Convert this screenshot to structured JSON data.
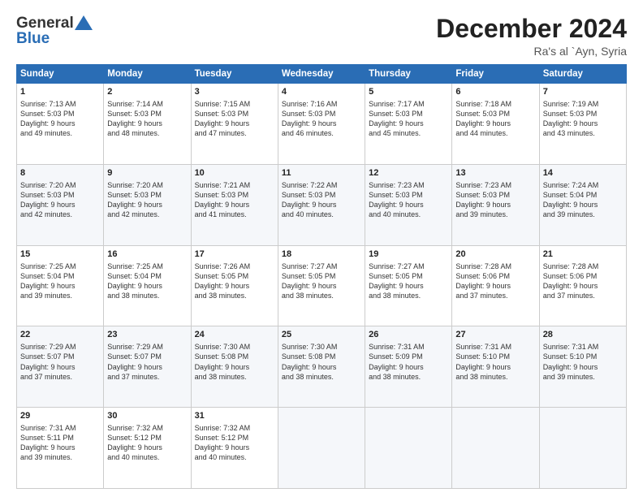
{
  "header": {
    "logo_general": "General",
    "logo_blue": "Blue",
    "month_title": "December 2024",
    "location": "Ra's al `Ayn, Syria"
  },
  "days_of_week": [
    "Sunday",
    "Monday",
    "Tuesday",
    "Wednesday",
    "Thursday",
    "Friday",
    "Saturday"
  ],
  "weeks": [
    [
      {
        "day": "1",
        "lines": [
          "Sunrise: 7:13 AM",
          "Sunset: 5:03 PM",
          "Daylight: 9 hours",
          "and 49 minutes."
        ]
      },
      {
        "day": "2",
        "lines": [
          "Sunrise: 7:14 AM",
          "Sunset: 5:03 PM",
          "Daylight: 9 hours",
          "and 48 minutes."
        ]
      },
      {
        "day": "3",
        "lines": [
          "Sunrise: 7:15 AM",
          "Sunset: 5:03 PM",
          "Daylight: 9 hours",
          "and 47 minutes."
        ]
      },
      {
        "day": "4",
        "lines": [
          "Sunrise: 7:16 AM",
          "Sunset: 5:03 PM",
          "Daylight: 9 hours",
          "and 46 minutes."
        ]
      },
      {
        "day": "5",
        "lines": [
          "Sunrise: 7:17 AM",
          "Sunset: 5:03 PM",
          "Daylight: 9 hours",
          "and 45 minutes."
        ]
      },
      {
        "day": "6",
        "lines": [
          "Sunrise: 7:18 AM",
          "Sunset: 5:03 PM",
          "Daylight: 9 hours",
          "and 44 minutes."
        ]
      },
      {
        "day": "7",
        "lines": [
          "Sunrise: 7:19 AM",
          "Sunset: 5:03 PM",
          "Daylight: 9 hours",
          "and 43 minutes."
        ]
      }
    ],
    [
      {
        "day": "8",
        "lines": [
          "Sunrise: 7:20 AM",
          "Sunset: 5:03 PM",
          "Daylight: 9 hours",
          "and 42 minutes."
        ]
      },
      {
        "day": "9",
        "lines": [
          "Sunrise: 7:20 AM",
          "Sunset: 5:03 PM",
          "Daylight: 9 hours",
          "and 42 minutes."
        ]
      },
      {
        "day": "10",
        "lines": [
          "Sunrise: 7:21 AM",
          "Sunset: 5:03 PM",
          "Daylight: 9 hours",
          "and 41 minutes."
        ]
      },
      {
        "day": "11",
        "lines": [
          "Sunrise: 7:22 AM",
          "Sunset: 5:03 PM",
          "Daylight: 9 hours",
          "and 40 minutes."
        ]
      },
      {
        "day": "12",
        "lines": [
          "Sunrise: 7:23 AM",
          "Sunset: 5:03 PM",
          "Daylight: 9 hours",
          "and 40 minutes."
        ]
      },
      {
        "day": "13",
        "lines": [
          "Sunrise: 7:23 AM",
          "Sunset: 5:03 PM",
          "Daylight: 9 hours",
          "and 39 minutes."
        ]
      },
      {
        "day": "14",
        "lines": [
          "Sunrise: 7:24 AM",
          "Sunset: 5:04 PM",
          "Daylight: 9 hours",
          "and 39 minutes."
        ]
      }
    ],
    [
      {
        "day": "15",
        "lines": [
          "Sunrise: 7:25 AM",
          "Sunset: 5:04 PM",
          "Daylight: 9 hours",
          "and 39 minutes."
        ]
      },
      {
        "day": "16",
        "lines": [
          "Sunrise: 7:25 AM",
          "Sunset: 5:04 PM",
          "Daylight: 9 hours",
          "and 38 minutes."
        ]
      },
      {
        "day": "17",
        "lines": [
          "Sunrise: 7:26 AM",
          "Sunset: 5:05 PM",
          "Daylight: 9 hours",
          "and 38 minutes."
        ]
      },
      {
        "day": "18",
        "lines": [
          "Sunrise: 7:27 AM",
          "Sunset: 5:05 PM",
          "Daylight: 9 hours",
          "and 38 minutes."
        ]
      },
      {
        "day": "19",
        "lines": [
          "Sunrise: 7:27 AM",
          "Sunset: 5:05 PM",
          "Daylight: 9 hours",
          "and 38 minutes."
        ]
      },
      {
        "day": "20",
        "lines": [
          "Sunrise: 7:28 AM",
          "Sunset: 5:06 PM",
          "Daylight: 9 hours",
          "and 37 minutes."
        ]
      },
      {
        "day": "21",
        "lines": [
          "Sunrise: 7:28 AM",
          "Sunset: 5:06 PM",
          "Daylight: 9 hours",
          "and 37 minutes."
        ]
      }
    ],
    [
      {
        "day": "22",
        "lines": [
          "Sunrise: 7:29 AM",
          "Sunset: 5:07 PM",
          "Daylight: 9 hours",
          "and 37 minutes."
        ]
      },
      {
        "day": "23",
        "lines": [
          "Sunrise: 7:29 AM",
          "Sunset: 5:07 PM",
          "Daylight: 9 hours",
          "and 37 minutes."
        ]
      },
      {
        "day": "24",
        "lines": [
          "Sunrise: 7:30 AM",
          "Sunset: 5:08 PM",
          "Daylight: 9 hours",
          "and 38 minutes."
        ]
      },
      {
        "day": "25",
        "lines": [
          "Sunrise: 7:30 AM",
          "Sunset: 5:08 PM",
          "Daylight: 9 hours",
          "and 38 minutes."
        ]
      },
      {
        "day": "26",
        "lines": [
          "Sunrise: 7:31 AM",
          "Sunset: 5:09 PM",
          "Daylight: 9 hours",
          "and 38 minutes."
        ]
      },
      {
        "day": "27",
        "lines": [
          "Sunrise: 7:31 AM",
          "Sunset: 5:10 PM",
          "Daylight: 9 hours",
          "and 38 minutes."
        ]
      },
      {
        "day": "28",
        "lines": [
          "Sunrise: 7:31 AM",
          "Sunset: 5:10 PM",
          "Daylight: 9 hours",
          "and 39 minutes."
        ]
      }
    ],
    [
      {
        "day": "29",
        "lines": [
          "Sunrise: 7:31 AM",
          "Sunset: 5:11 PM",
          "Daylight: 9 hours",
          "and 39 minutes."
        ]
      },
      {
        "day": "30",
        "lines": [
          "Sunrise: 7:32 AM",
          "Sunset: 5:12 PM",
          "Daylight: 9 hours",
          "and 40 minutes."
        ]
      },
      {
        "day": "31",
        "lines": [
          "Sunrise: 7:32 AM",
          "Sunset: 5:12 PM",
          "Daylight: 9 hours",
          "and 40 minutes."
        ]
      },
      null,
      null,
      null,
      null
    ]
  ]
}
